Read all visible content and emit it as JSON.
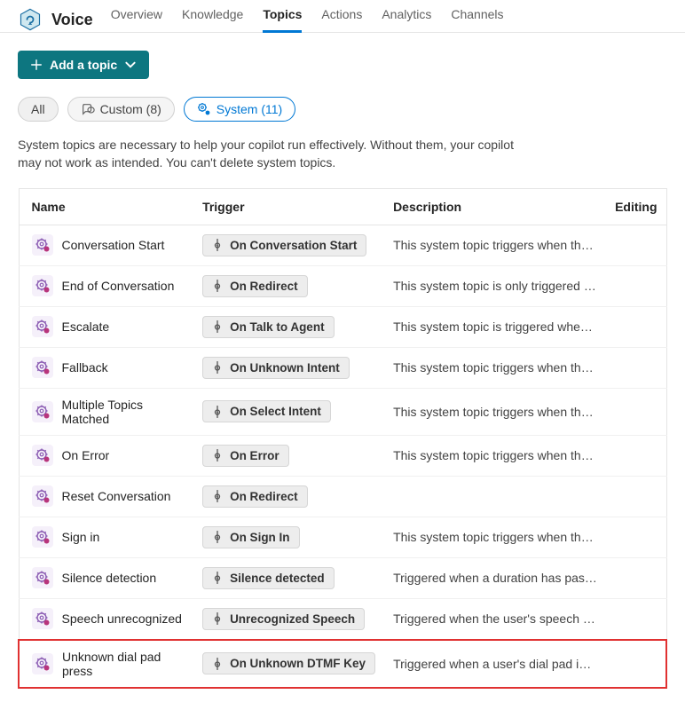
{
  "app": {
    "title": "Voice"
  },
  "nav": {
    "items": [
      {
        "label": "Overview"
      },
      {
        "label": "Knowledge"
      },
      {
        "label": "Topics",
        "active": true
      },
      {
        "label": "Actions"
      },
      {
        "label": "Analytics"
      },
      {
        "label": "Channels"
      }
    ]
  },
  "buttons": {
    "add_topic": "Add a topic"
  },
  "filters": {
    "all": "All",
    "custom": "Custom (8)",
    "system": "System (11)"
  },
  "info": "System topics are necessary to help your copilot run effectively. Without them, your copilot may not work as intended. You can't delete system topics.",
  "table": {
    "headers": {
      "name": "Name",
      "trigger": "Trigger",
      "description": "Description",
      "editing": "Editing"
    },
    "rows": [
      {
        "name": "Conversation Start",
        "trigger": "On Conversation Start",
        "description": "This system topic triggers when the b..."
      },
      {
        "name": "End of Conversation",
        "trigger": "On Redirect",
        "description": "This system topic is only triggered by ..."
      },
      {
        "name": "Escalate",
        "trigger": "On Talk to Agent",
        "description": "This system topic is triggered when t..."
      },
      {
        "name": "Fallback",
        "trigger": "On Unknown Intent",
        "description": "This system topic triggers when the u..."
      },
      {
        "name": "Multiple Topics Matched",
        "trigger": "On Select Intent",
        "description": "This system topic triggers when the b..."
      },
      {
        "name": "On Error",
        "trigger": "On Error",
        "description": "This system topic triggers when the b..."
      },
      {
        "name": "Reset Conversation",
        "trigger": "On Redirect",
        "description": ""
      },
      {
        "name": "Sign in",
        "trigger": "On Sign In",
        "description": "This system topic triggers when the b..."
      },
      {
        "name": "Silence detection",
        "trigger": "Silence detected",
        "description": "Triggered when a duration has passe..."
      },
      {
        "name": "Speech unrecognized",
        "trigger": "Unrecognized Speech",
        "description": "Triggered when the user's speech inp..."
      },
      {
        "name": "Unknown dial pad press",
        "trigger": "On Unknown DTMF Key",
        "description": "Triggered when a user's dial pad inpu...",
        "highlight": true
      }
    ]
  }
}
